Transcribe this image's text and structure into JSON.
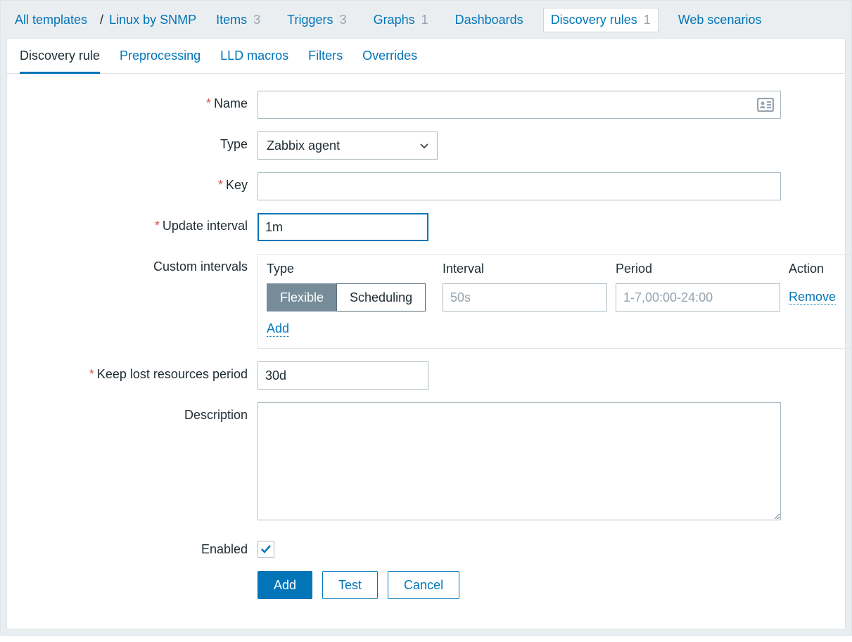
{
  "breadcrumb": {
    "all_templates": "All templates",
    "sep": "/",
    "template_name": "Linux by SNMP"
  },
  "topnav": {
    "items": {
      "label": "Items",
      "count": "3"
    },
    "triggers": {
      "label": "Triggers",
      "count": "3"
    },
    "graphs": {
      "label": "Graphs",
      "count": "1"
    },
    "dashboards": {
      "label": "Dashboards"
    },
    "discovery_rules": {
      "label": "Discovery rules",
      "count": "1"
    },
    "web_scenarios": {
      "label": "Web scenarios"
    }
  },
  "tabs": {
    "discovery_rule": "Discovery rule",
    "preprocessing": "Preprocessing",
    "lld_macros": "LLD macros",
    "filters": "Filters",
    "overrides": "Overrides"
  },
  "form": {
    "name_label": "Name",
    "name_value": "",
    "type_label": "Type",
    "type_value": "Zabbix agent",
    "key_label": "Key",
    "key_value": "",
    "update_interval_label": "Update interval",
    "update_interval_value": "1m",
    "custom_intervals_label": "Custom intervals",
    "custom_intervals": {
      "head_type": "Type",
      "head_interval": "Interval",
      "head_period": "Period",
      "head_action": "Action",
      "flexible": "Flexible",
      "scheduling": "Scheduling",
      "interval_placeholder": "50s",
      "period_placeholder": "1-7,00:00-24:00",
      "remove": "Remove",
      "add": "Add"
    },
    "keep_lost_label": "Keep lost resources period",
    "keep_lost_value": "30d",
    "description_label": "Description",
    "description_value": "",
    "enabled_label": "Enabled",
    "enabled_checked": true
  },
  "buttons": {
    "add": "Add",
    "test": "Test",
    "cancel": "Cancel"
  }
}
